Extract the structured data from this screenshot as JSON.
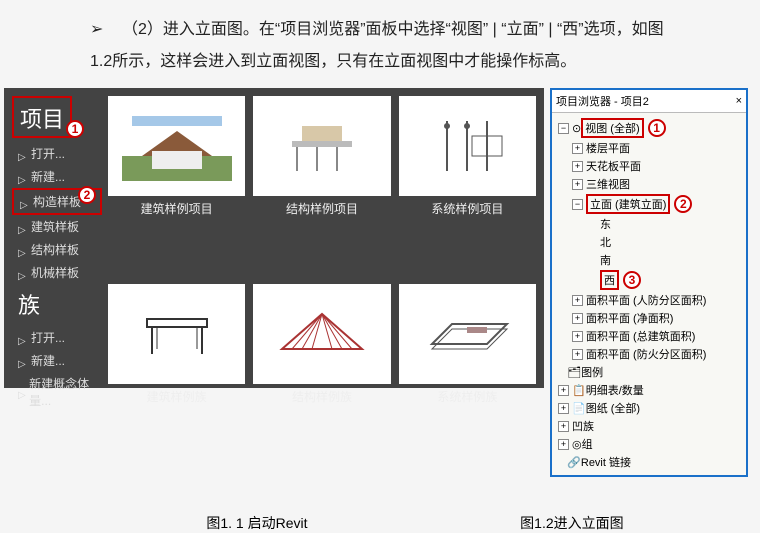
{
  "instruction": {
    "bullet": "➢",
    "text": "（2）进入立面图。在“项目浏览器”面板中选择“视图” | “立面” | “西”选项，如图1.2所示，这样会进入到立面视图，只有在立面视图中才能操作标高。"
  },
  "revit_start": {
    "proj_title": "项目",
    "proj_items": [
      "打开...",
      "新建...",
      "构造样板",
      "建筑样板",
      "结构样板",
      "机械样板"
    ],
    "fam_title": "族",
    "fam_items": [
      "打开...",
      "新建...",
      "新建概念体量..."
    ],
    "proj_tiles": [
      "建筑样例项目",
      "结构样例项目",
      "系统样例项目"
    ],
    "fam_tiles": [
      "建筑样例族",
      "结构样例族",
      "系统样例族"
    ]
  },
  "callouts": {
    "c1": "1",
    "c2": "2",
    "c3": "3"
  },
  "browser": {
    "title": "项目浏览器 - 项目2",
    "close": "×",
    "nodes": {
      "views_all": "视图 (全部)",
      "floor_plan": "楼层平面",
      "ceiling_plan": "天花板平面",
      "three_d": "三维视图",
      "elev": "立面 (建筑立面)",
      "east": "东",
      "north": "北",
      "south": "南",
      "west": "西",
      "area1": "面积平面 (人防分区面积)",
      "area2": "面积平面 (净面积)",
      "area3": "面积平面 (总建筑面积)",
      "area4": "面积平面 (防火分区面积)",
      "legend": "图例",
      "schedule": "明细表/数量",
      "sheets": "图纸 (全部)",
      "families": "族",
      "groups": "组",
      "links": "Revit 链接"
    }
  },
  "captions": {
    "left": "图1. 1  启动Revit",
    "right": "图1.2进入立面图"
  }
}
